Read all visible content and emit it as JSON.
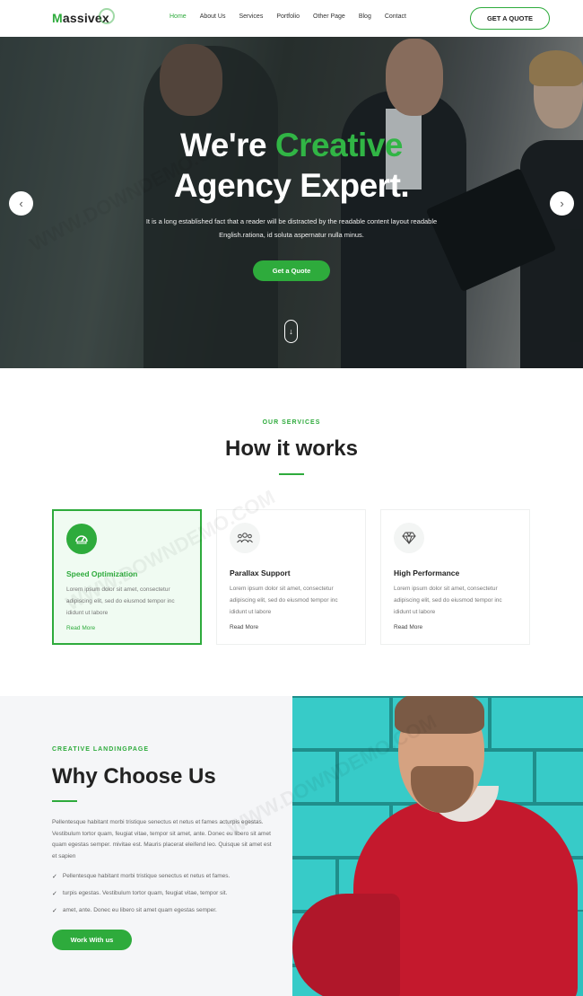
{
  "header": {
    "logo": "Massivex",
    "nav": [
      {
        "label": "Home",
        "active": true
      },
      {
        "label": "About Us",
        "active": false
      },
      {
        "label": "Services",
        "active": false
      },
      {
        "label": "Portfolio",
        "active": false
      },
      {
        "label": "Other Page",
        "active": false
      },
      {
        "label": "Blog",
        "active": false
      },
      {
        "label": "Contact",
        "active": false
      }
    ],
    "cta": "GET A QUOTE"
  },
  "hero": {
    "title_prefix": "We're ",
    "title_highlight": "Creative",
    "title_line2": "Agency Expert.",
    "subtitle": "It is a long established fact that a reader will be distracted by the readable content layout readable English.rationa, id soluta aspernatur nulla minus.",
    "button": "Get a Quote",
    "prev_icon": "chevron-left-icon",
    "next_icon": "chevron-right-icon",
    "scroll_icon": "scroll-down-icon"
  },
  "services": {
    "kicker": "OUR SERVICES",
    "title": "How it works",
    "cards": [
      {
        "icon": "speedometer-icon",
        "title": "Speed Optimization",
        "desc": "Lorem ipsum dolor sit amet, consectetur adipiscing elit, sed do eiusmod tempor inc ididunt ut labore",
        "link": "Read More"
      },
      {
        "icon": "users-icon",
        "title": "Parallax Support",
        "desc": "Lorem ipsum dolor sit amet, consectetur adipiscing elit, sed do eiusmod tempor inc ididunt ut labore",
        "link": "Read More"
      },
      {
        "icon": "diamond-icon",
        "title": "High Performance",
        "desc": "Lorem ipsum dolor sit amet, consectetur adipiscing elit, sed do eiusmod tempor inc ididunt ut labore",
        "link": "Read More"
      }
    ]
  },
  "why": {
    "kicker": "CREATIVE LANDINGPAGE",
    "title": "Why Choose Us",
    "paragraph": "Pellentesque habitant morbi tristique senectus et netus et fames acturpis egestas. Vestibulum tortor quam, feugiat vitae, tempor sit amet, ante. Donec eu libero sit amet quam egestas semper. mivitae est. Mauris placerat eleifend leo. Quisque sit amet est et sapien",
    "bullets": [
      "Pellentesque habitant morbi tristique senectus et netus et fames.",
      "turpis egestas. Vestibulum tortor quam, feugiat vitae, tempor sit.",
      "amet, ante. Donec eu libero sit amet quam egestas semper."
    ],
    "button": "Work With us"
  },
  "watermark": "WWW.DOWNDEMO.COM",
  "colors": {
    "accent": "#2eab3c",
    "text": "#222222",
    "muted": "#777777"
  }
}
